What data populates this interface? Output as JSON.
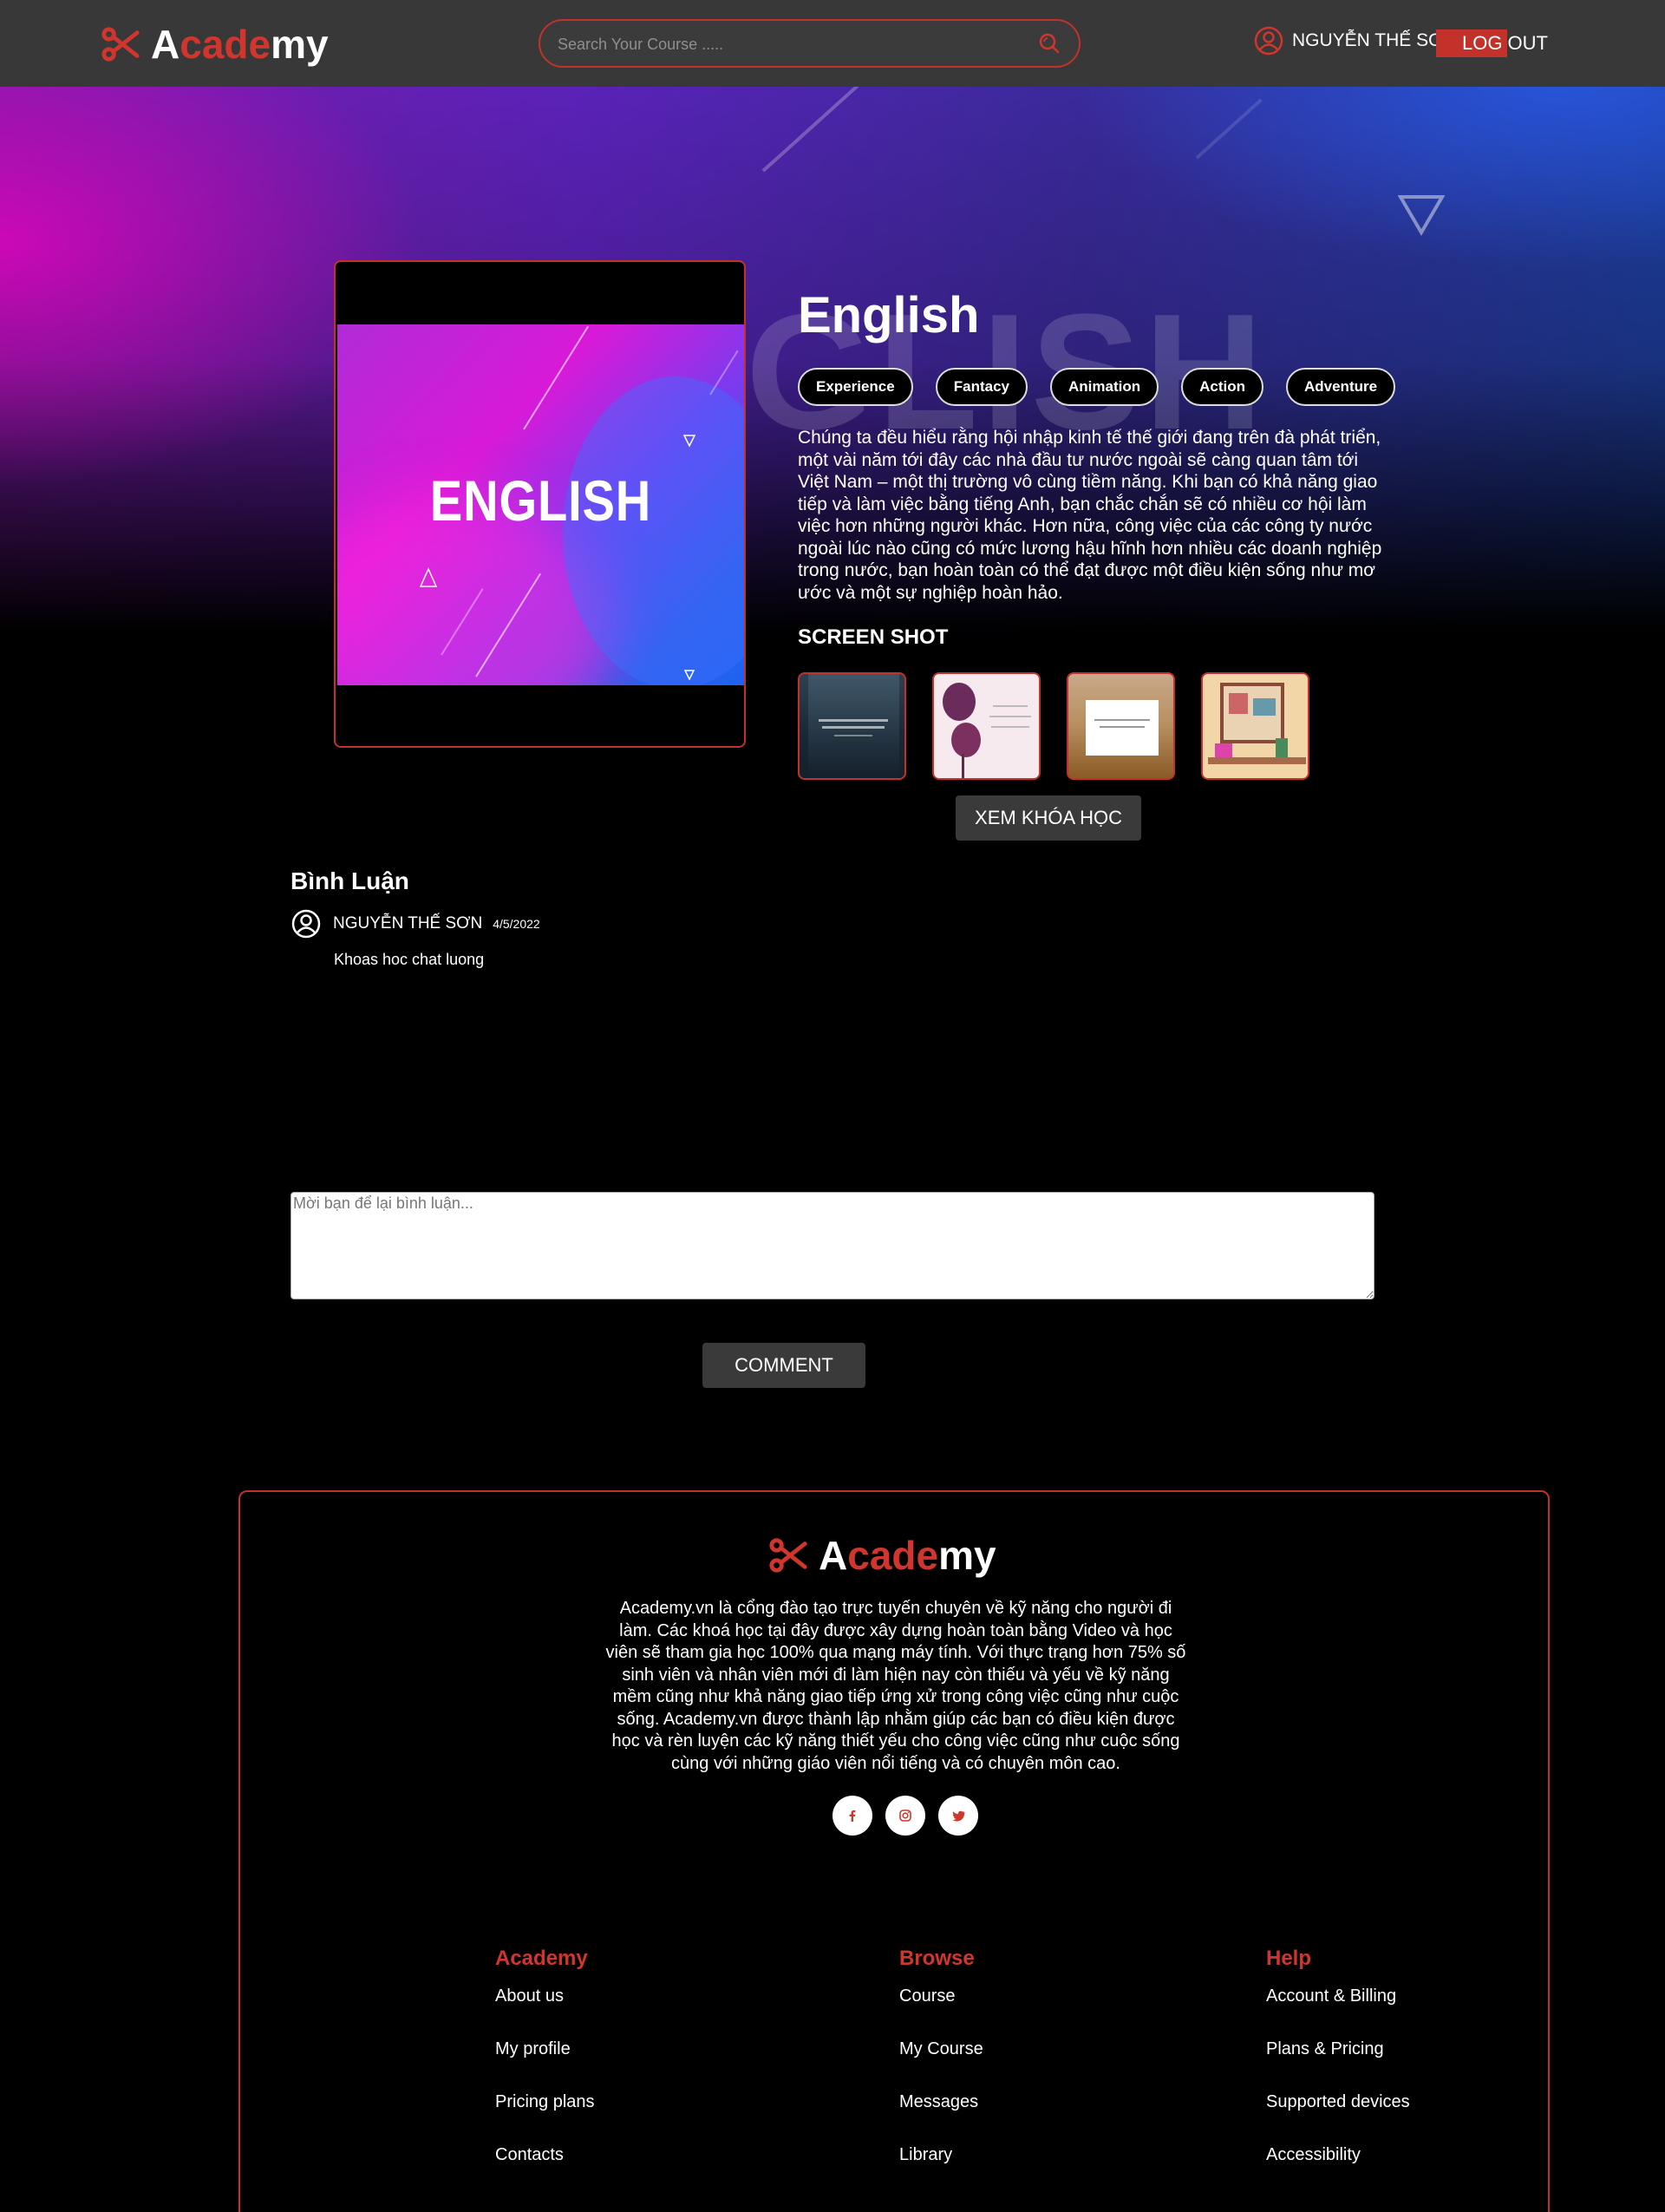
{
  "brand": {
    "logo_a": "A",
    "logo_cade": "cade",
    "logo_my": "my"
  },
  "header": {
    "search_placeholder": "Search Your Course .....",
    "user_name": "NGUYỄN THẾ SƠN",
    "logout_part1": "LOG",
    "logout_part2": "OUT"
  },
  "course": {
    "thumbnail_text": "ENGLISH",
    "title": "English",
    "background_word": "GLISH",
    "tags": [
      "Experience",
      "Fantacy",
      "Animation",
      "Action",
      "Adventure"
    ],
    "description": "Chúng ta đều hiểu rằng hội nhập kinh tế thế giới đang trên đà phát triển, một vài năm tới đây các nhà đầu tư nước ngoài sẽ càng quan tâm tới Việt Nam – một thị trường vô cùng tiềm năng. Khi bạn có khả năng giao tiếp và làm việc bằng tiếng Anh, bạn chắc chắn sẽ có nhiều cơ hội làm việc hơn những người khác. Hơn nữa, công việc của các công ty nước ngoài lúc nào cũng có mức lương hậu hĩnh hơn nhiều các doanh nghiệp trong nước, bạn hoàn toàn có thể đạt được một điều kiện sống như mơ ước và một sự nghiệp hoàn hảo.",
    "screenshot_heading": "SCREEN SHOT",
    "view_button": "XEM KHÓA HỌC"
  },
  "comments": {
    "title": "Bình Luận",
    "items": [
      {
        "user": "NGUYỄN THẾ SƠN",
        "date": "4/5/2022",
        "text": "Khoas hoc chat luong"
      }
    ],
    "input_placeholder": "Mời bạn để lại bình luận...",
    "submit_label": "COMMENT"
  },
  "footer": {
    "about": "Academy.vn là cổng đào tạo trực tuyến chuyên về kỹ năng cho người đi làm. Các khoá học tại đây được xây dựng hoàn toàn bằng Video và học viên sẽ tham gia học 100% qua mạng máy tính. Với thực trạng hơn 75% số sinh viên và nhân viên mới đi làm hiện nay còn thiếu và yếu về kỹ năng mềm cũng như khả năng giao tiếp ứng xử trong công việc cũng như cuộc sống. Academy.vn được thành lập nhằm giúp các bạn có điều kiện được học và rèn luyện các kỹ năng thiết yếu cho công việc cũng như cuộc sống cùng với những giáo viên nổi tiếng và có chuyên môn cao.",
    "socials": [
      "facebook-icon",
      "instagram-icon",
      "twitter-icon"
    ],
    "columns": [
      {
        "heading": "Academy",
        "links": [
          "About us",
          "My profile",
          "Pricing plans",
          "Contacts"
        ]
      },
      {
        "heading": "Browse",
        "links": [
          "Course",
          "My Course",
          "Messages",
          "Library"
        ]
      },
      {
        "heading": "Help",
        "links": [
          "Account & Billing",
          "Plans & Pricing",
          "Supported devices",
          "Accessibility"
        ]
      }
    ]
  },
  "colors": {
    "accent": "#c2322b",
    "header_bg": "#383838",
    "button_bg": "#3a3a3a"
  }
}
